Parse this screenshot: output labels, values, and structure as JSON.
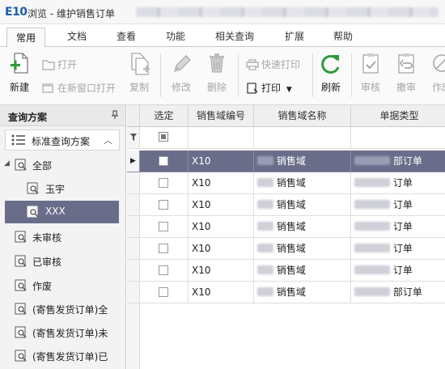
{
  "app": {
    "logo": "E10",
    "title": "浏览 - 维护销售订单"
  },
  "ribbon_tabs": [
    {
      "label": "常用",
      "active": true
    },
    {
      "label": "文档"
    },
    {
      "label": "查看"
    },
    {
      "label": "功能"
    },
    {
      "label": "相关查询"
    },
    {
      "label": "扩展"
    },
    {
      "label": "帮助"
    }
  ],
  "toolbar": {
    "new_label": "新建",
    "open_label": "打开",
    "open_new_window_label": "在新窗口打开",
    "copy_label": "复制",
    "modify_label": "修改",
    "delete_label": "删除",
    "quick_print_label": "快速打印",
    "print_label": "打印",
    "refresh_label": "刷新",
    "review_label": "审核",
    "unreview_label": "撤审",
    "void_label": "作废"
  },
  "left_panel": {
    "title": "查询方案",
    "pin": "ꟼ",
    "scheme_label": "标准查询方案",
    "tree": [
      {
        "label": "全部",
        "level": 0,
        "expanded": true
      },
      {
        "label": "玉宇",
        "level": 1
      },
      {
        "label": "XXX",
        "level": 1,
        "selected": true
      },
      {
        "label": "未审核",
        "level": 0
      },
      {
        "label": "已审核",
        "level": 0
      },
      {
        "label": "作废",
        "level": 0
      },
      {
        "label": "(寄售发货订单)全",
        "level": 0
      },
      {
        "label": "(寄售发货订单)未",
        "level": 0
      },
      {
        "label": "(寄售发货订单)已",
        "level": 0
      }
    ]
  },
  "grid": {
    "columns": [
      "选定",
      "销售域编号",
      "销售域名称",
      "单据类型"
    ],
    "rows": [
      {
        "code": "X10",
        "name": "销售域",
        "type": "部订单",
        "selected": true
      },
      {
        "code": "X10",
        "name": "销售域",
        "type": "订单"
      },
      {
        "code": "X10",
        "name": "销售域",
        "type": "订单"
      },
      {
        "code": "X10",
        "name": "销售域",
        "type": "订单"
      },
      {
        "code": "X10",
        "name": "销售域",
        "type": "订单"
      },
      {
        "code": "X10",
        "name": "销售域",
        "type": "订单"
      },
      {
        "code": "X10",
        "name": "销售域",
        "type": "部订单"
      }
    ]
  },
  "colors": {
    "selection": "#6a6d8a",
    "refresh_green": "#2f9a3c",
    "logo_blue": "#1b5ea8"
  },
  "icons": {
    "new": "new-doc-plus-icon",
    "open": "folder-icon",
    "copy": "copy-icon",
    "modify": "pencil-icon",
    "delete": "trash-icon",
    "quick_print": "quick-print-icon",
    "print": "printer-icon",
    "refresh": "refresh-icon",
    "review": "clipboard-check-icon",
    "unreview": "clipboard-undo-icon"
  }
}
